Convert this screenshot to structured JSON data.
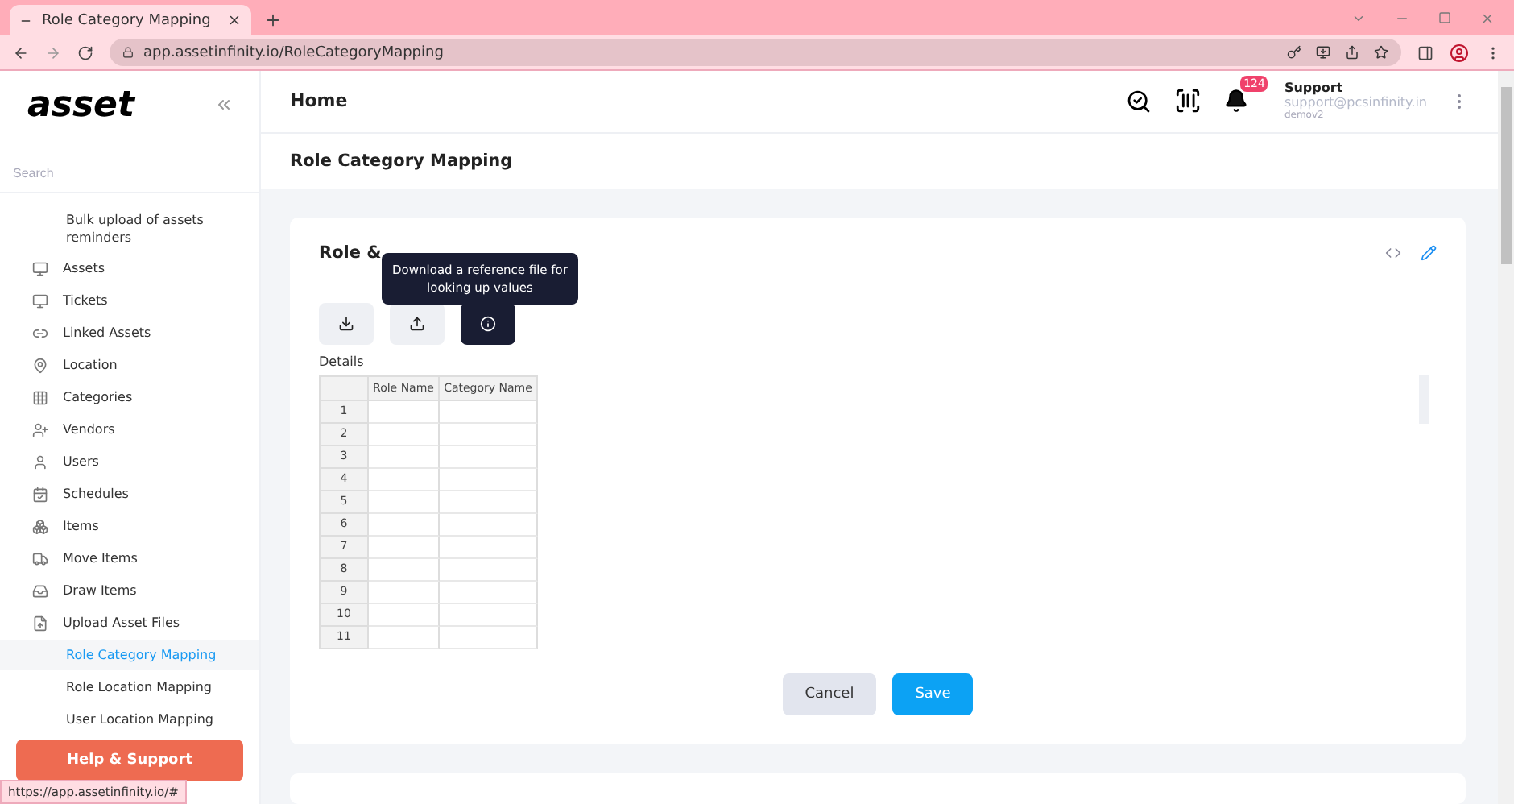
{
  "browser": {
    "tab_title": "Role Category Mapping",
    "url": "app.assetinfinity.io/RoleCategoryMapping",
    "status_url": "https://app.assetinfinity.io/#"
  },
  "sidebar": {
    "logo": "asset",
    "search_placeholder": "Search",
    "items": [
      {
        "label": "Bulk upload of assets reminders",
        "kind": "plain",
        "selected": false
      },
      {
        "label": "Assets",
        "kind": "monitor",
        "selected": false
      },
      {
        "label": "Tickets",
        "kind": "monitor",
        "selected": false
      },
      {
        "label": "Linked Assets",
        "kind": "link",
        "selected": false
      },
      {
        "label": "Location",
        "kind": "pin",
        "selected": false
      },
      {
        "label": "Categories",
        "kind": "grid",
        "selected": false
      },
      {
        "label": "Vendors",
        "kind": "user-plus",
        "selected": false
      },
      {
        "label": "Users",
        "kind": "user",
        "selected": false
      },
      {
        "label": "Schedules",
        "kind": "calendar",
        "selected": false
      },
      {
        "label": "Items",
        "kind": "boxes",
        "selected": false
      },
      {
        "label": "Move Items",
        "kind": "truck",
        "selected": false
      },
      {
        "label": "Draw Items",
        "kind": "tray",
        "selected": false
      },
      {
        "label": "Upload Asset Files",
        "kind": "upload",
        "selected": false
      },
      {
        "label": "Role Category Mapping",
        "kind": "plain",
        "selected": true
      },
      {
        "label": "Role Location Mapping",
        "kind": "plain",
        "selected": false
      },
      {
        "label": "User Location Mapping",
        "kind": "plain",
        "selected": false
      }
    ],
    "help_button": "Help & Support"
  },
  "header": {
    "title": "Home",
    "notification_count": "124",
    "user_name": "Support",
    "user_email": "support@pcsinfinity.in",
    "user_org": "demov2"
  },
  "page_title": "Role Category Mapping",
  "card": {
    "title": "Role &",
    "tooltip": "Download a reference file for looking up values",
    "details_label": "Details",
    "table": {
      "columns": [
        "Role Name",
        "Category Name"
      ],
      "row_numbers": [
        "1",
        "2",
        "3",
        "4",
        "5",
        "6",
        "7",
        "8",
        "9",
        "10",
        "11"
      ]
    },
    "buttons": [
      {
        "label": "Cancel",
        "kind": "secondary"
      },
      {
        "label": "Save",
        "kind": "primary"
      }
    ]
  }
}
